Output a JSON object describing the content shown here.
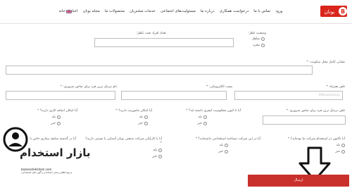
{
  "nav": {
    "logo_text": "بونان",
    "items": [
      "خانه",
      "اخبار",
      "مجله بونان",
      "محصولات ما",
      "خدمات مشتریان",
      "مسئولیت‌های اجتماعی",
      "درباره ما",
      "درخواست همکاری",
      "تماس با ما",
      "ورود"
    ],
    "left_links": [
      "ورود"
    ]
  },
  "form": {
    "marital_label": "وضعیت تاهل:",
    "marital_options": [
      "متاهل",
      "مجرد"
    ],
    "dependents_label": "تعداد افراد تحت تکفل:",
    "address_label": "نشانی کامل محل سکونت: *",
    "mobile_label": "تلفن همراه: *",
    "mobile_placeholder": "09xxxxxxxxx",
    "email_label": "پست الکترونیکی: *",
    "emergency_name_label": "نام نزدیک ترین فرد برای تماس ضروری: *",
    "emergency_phone_label": "تلفن نزدیک ترین فرد برای تماس ضروری: *",
    "q_conviction": "آیا تا کنون محکومیت کیفری داشته اید؟ *",
    "q_mission": "آیا امکان ماموریت دارید؟ *",
    "q_overtime": "آیا امکان اضافه کاری دارید؟ *",
    "q_previous_apply": "آیا تاکنون در استخدام شرکت ما بوده‌اید؟ *",
    "q_disease": "آیا در گذشته سابقه بیماری خاص یا",
    "q_acquaintance": "آیا با کارکنان شرکت صنعتی بونان آشنایی یا نسبتی دارید؟ *",
    "q_exam": "آیا در این شرکت مصاحبه استخدامی داشته‌اید؟ *",
    "yes": "بله",
    "no": "خیر",
    "submit_label": "ارسال"
  },
  "watermark": {
    "title": "بازار استخدام",
    "url": "bazarestekhdam.com",
    "subtitle": "مرجع اطلاع رسانی استخدام و آگهی های استخدامی"
  }
}
